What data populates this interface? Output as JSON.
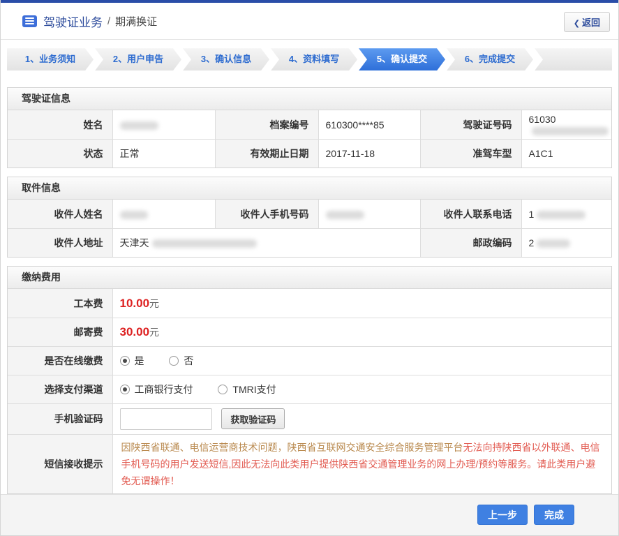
{
  "header": {
    "title_primary": "驾驶证业务",
    "separator": "/",
    "title_secondary": "期满换证",
    "back_chevron": "❮",
    "back_label": "返回"
  },
  "steps": [
    {
      "label": "1、业务须知",
      "active": false
    },
    {
      "label": "2、用户申告",
      "active": false
    },
    {
      "label": "3、确认信息",
      "active": false
    },
    {
      "label": "4、资料填写",
      "active": false
    },
    {
      "label": "5、确认提交",
      "active": true
    },
    {
      "label": "6、完成提交",
      "active": false
    }
  ],
  "sections": {
    "license": {
      "title": "驾驶证信息",
      "fields": {
        "name": {
          "label": "姓名",
          "value": "",
          "redacted": true
        },
        "file_no": {
          "label": "档案编号",
          "value": "610300****85",
          "redacted": false
        },
        "license_no": {
          "label": "驾驶证号码",
          "value": "61030",
          "redacted": true
        },
        "status": {
          "label": "状态",
          "value": "正常",
          "redacted": false
        },
        "valid_until": {
          "label": "有效期止日期",
          "value": "2017-11-18",
          "redacted": false
        },
        "vehicle_class": {
          "label": "准驾车型",
          "value": "A1C1",
          "redacted": false
        }
      }
    },
    "pickup": {
      "title": "取件信息",
      "fields": {
        "recipient_name": {
          "label": "收件人姓名",
          "value": "",
          "redacted": true
        },
        "recipient_mobile": {
          "label": "收件人手机号码",
          "value": "",
          "redacted": true
        },
        "recipient_phone": {
          "label": "收件人联系电话",
          "value": "1",
          "redacted": true
        },
        "recipient_address": {
          "label": "收件人地址",
          "value": "天津天",
          "redacted": true
        },
        "postal_code": {
          "label": "邮政编码",
          "value": "2",
          "redacted": true
        }
      }
    },
    "fees": {
      "title": "缴纳费用",
      "production_fee": {
        "label": "工本费",
        "amount": "10.00",
        "unit": "元"
      },
      "postage_fee": {
        "label": "邮寄费",
        "amount": "30.00",
        "unit": "元"
      },
      "online_payment": {
        "label": "是否在线缴费",
        "options": [
          {
            "label": "是",
            "selected": true
          },
          {
            "label": "否",
            "selected": false
          }
        ]
      },
      "payment_channel": {
        "label": "选择支付渠道",
        "options": [
          {
            "label": "工商银行支付",
            "selected": true
          },
          {
            "label": "TMRI支付",
            "selected": false
          }
        ]
      },
      "sms_code": {
        "label": "手机验证码",
        "input_value": "",
        "button_label": "获取验证码"
      },
      "sms_notice": {
        "label": "短信接收提示",
        "text_part1": "因陕西省联通、电信运营商技术问题，陕西省互联网交通安全综合服务管理平台",
        "text_part2": "无法向持陕西省以外联通、电信手机号码的用户发送短信,因此无法向此类用户提供陕西省交通管理业务的网上办理/预约等服务。请此类用户避免无谓操作！"
      }
    }
  },
  "footer": {
    "prev_label": "上一步",
    "finish_label": "完成"
  },
  "colors": {
    "top_bar": "#2a4da8",
    "accent_blue": "#3f80e2",
    "step_active_blue": "#2e6fd9",
    "navy_title": "#2b4a9b",
    "fee_red": "#dd2121",
    "notice_tan": "#b9894e",
    "notice_red": "#e25a50"
  }
}
